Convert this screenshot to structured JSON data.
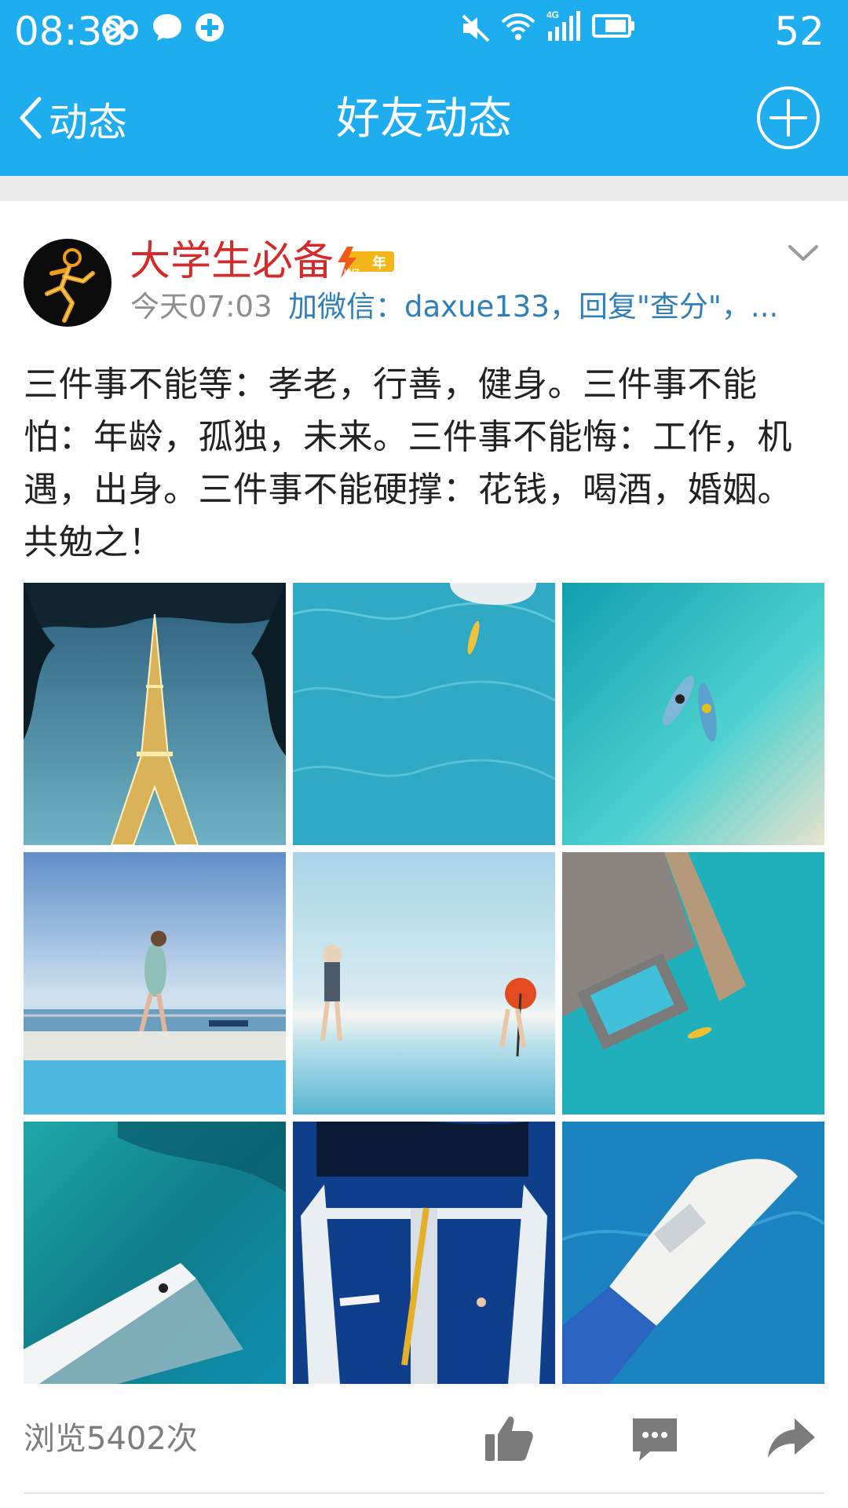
{
  "status_bar": {
    "time": "08:38",
    "battery": "52",
    "network": "4G",
    "icons": [
      "infinity-icon",
      "chat-bubble-icon",
      "plus-cross-icon",
      "mute-icon",
      "wifi-icon",
      "signal-icon",
      "battery-icon"
    ]
  },
  "nav": {
    "back_label": "动态",
    "title": "好友动态",
    "add_icon": "add-circle-icon"
  },
  "post": {
    "author": "大学生必备",
    "badge_level": "LV7",
    "badge_year": "年",
    "time": "今天07:03",
    "source": "加微信：daxue133，回复\"查分\"，...",
    "text": "三件事不能等：孝老，行善，健身。三件事不能怕：年龄，孤独，未来。三件事不能悔：工作，机遇，出身。三件事不能硬撑：花钱，喝酒，婚姻。共勉之！",
    "photos": [
      {
        "subject": "eiffel-tower"
      },
      {
        "subject": "swimmer-in-pool"
      },
      {
        "subject": "kayaks-on-lagoon"
      },
      {
        "subject": "person-by-pool"
      },
      {
        "subject": "beach-with-umbrella"
      },
      {
        "subject": "overwater-villa"
      },
      {
        "subject": "catamaran-net-aerial"
      },
      {
        "subject": "catamaran-deck"
      },
      {
        "subject": "boat-on-sea"
      }
    ],
    "views": "浏览5402次",
    "actions": [
      "like-icon",
      "comment-icon",
      "share-icon"
    ]
  },
  "colors": {
    "accent": "#1eaef0",
    "author_name": "#d42b2b",
    "link": "#2f7fb8",
    "muted": "#8e8e8e"
  }
}
